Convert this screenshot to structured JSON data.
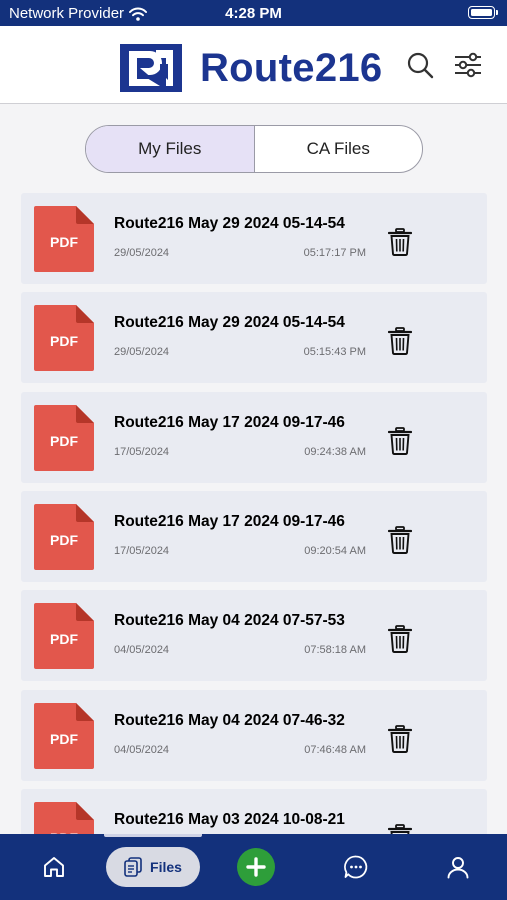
{
  "status_bar": {
    "carrier": "Network Provider",
    "time": "4:28 PM"
  },
  "header": {
    "app_name": "Route216"
  },
  "tabs": [
    {
      "label": "My Files",
      "active": true
    },
    {
      "label": "CA Files",
      "active": false
    }
  ],
  "pdf_badge": "PDF",
  "files": [
    {
      "name": "Route216 May 29 2024 05-14-54",
      "date": "29/05/2024",
      "time": "05:17:17 PM"
    },
    {
      "name": "Route216 May 29 2024 05-14-54",
      "date": "29/05/2024",
      "time": "05:15:43 PM"
    },
    {
      "name": "Route216 May 17 2024 09-17-46",
      "date": "17/05/2024",
      "time": "09:24:38 AM"
    },
    {
      "name": "Route216 May 17 2024 09-17-46",
      "date": "17/05/2024",
      "time": "09:20:54 AM"
    },
    {
      "name": "Route216 May 04 2024 07-57-53",
      "date": "04/05/2024",
      "time": "07:58:18 AM"
    },
    {
      "name": "Route216 May 04 2024 07-46-32",
      "date": "04/05/2024",
      "time": "07:46:48 AM"
    },
    {
      "name": "Route216 May 03 2024 10-08-21",
      "date": "",
      "time": ""
    }
  ],
  "bottom_nav": {
    "files_label": "Files"
  },
  "colors": {
    "brand_navy": "#13317c",
    "pdf_red": "#e2574c",
    "add_green": "#2e9e3a",
    "active_tab": "#e6e1f6"
  },
  "icons": [
    "wifi-icon",
    "battery-icon",
    "route216-logo-icon",
    "search-icon",
    "filter-icon",
    "pdf-file-icon",
    "trash-icon",
    "home-icon",
    "files-icon",
    "add-icon",
    "chat-icon",
    "profile-icon"
  ]
}
